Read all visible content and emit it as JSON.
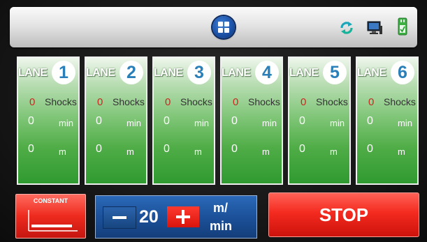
{
  "header": {
    "home_icon": "grid-menu-icon",
    "sync_icon": "refresh-sync-icon",
    "monitor_icon": "computer-monitor-icon",
    "device_icon": "device-check-icon",
    "colors": {
      "home_blue": "#1a4fa3",
      "sync_teal": "#19a6b8",
      "device_green": "#3cb043"
    }
  },
  "lanes": [
    {
      "label": "LANE",
      "number": "1",
      "shocks": "0",
      "shocks_label": "Shocks",
      "minutes": "0",
      "minutes_label": "min",
      "meters": "0",
      "meters_label": "m"
    },
    {
      "label": "LANE",
      "number": "2",
      "shocks": "0",
      "shocks_label": "Shocks",
      "minutes": "0",
      "minutes_label": "min",
      "meters": "0",
      "meters_label": "m"
    },
    {
      "label": "LANE",
      "number": "3",
      "shocks": "0",
      "shocks_label": "Shocks",
      "minutes": "0",
      "minutes_label": "min",
      "meters": "0",
      "meters_label": "m"
    },
    {
      "label": "LANE",
      "number": "4",
      "shocks": "0",
      "shocks_label": "Shocks",
      "minutes": "0",
      "minutes_label": "min",
      "meters": "0",
      "meters_label": "m"
    },
    {
      "label": "LANE",
      "number": "5",
      "shocks": "0",
      "shocks_label": "Shocks",
      "minutes": "0",
      "minutes_label": "min",
      "meters": "0",
      "meters_label": "m"
    },
    {
      "label": "LANE",
      "number": "6",
      "shocks": "0",
      "shocks_label": "Shocks",
      "minutes": "0",
      "minutes_label": "min",
      "meters": "0",
      "meters_label": "m"
    }
  ],
  "mode": {
    "title": "CONSTANT",
    "icon": "constant-speed-graph-icon"
  },
  "speed": {
    "value": "20",
    "unit_top": "m/",
    "unit_bottom": "min",
    "minus_icon": "minus-icon",
    "plus_icon": "plus-icon"
  },
  "stop": {
    "label": "STOP",
    "color": "#f42a1f"
  }
}
